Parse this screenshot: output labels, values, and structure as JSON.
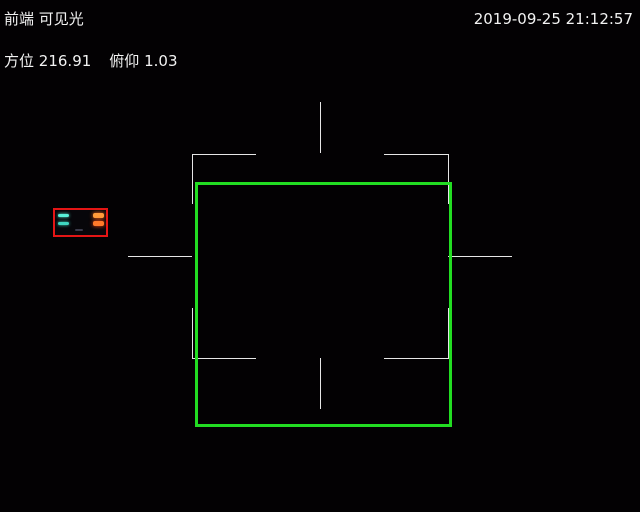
{
  "header": {
    "source_label": "前端  可见光",
    "timestamp": "2019-09-25 21:12:57"
  },
  "orientation": {
    "azimuth_label": "方位",
    "azimuth_value": "216.91",
    "elevation_label": "俯仰",
    "elevation_value": "1.03"
  },
  "colors": {
    "background": "#030103",
    "osd_text": "#f2f2f2",
    "crosshair": "#e6e6e6",
    "tracking_box": "#22dd22",
    "detection_box": "#e41515"
  },
  "icons": {
    "reticle": "crosshair-reticle-icon",
    "target_box": "tracking-box-icon",
    "detection": "vehicle-detection-icon"
  }
}
